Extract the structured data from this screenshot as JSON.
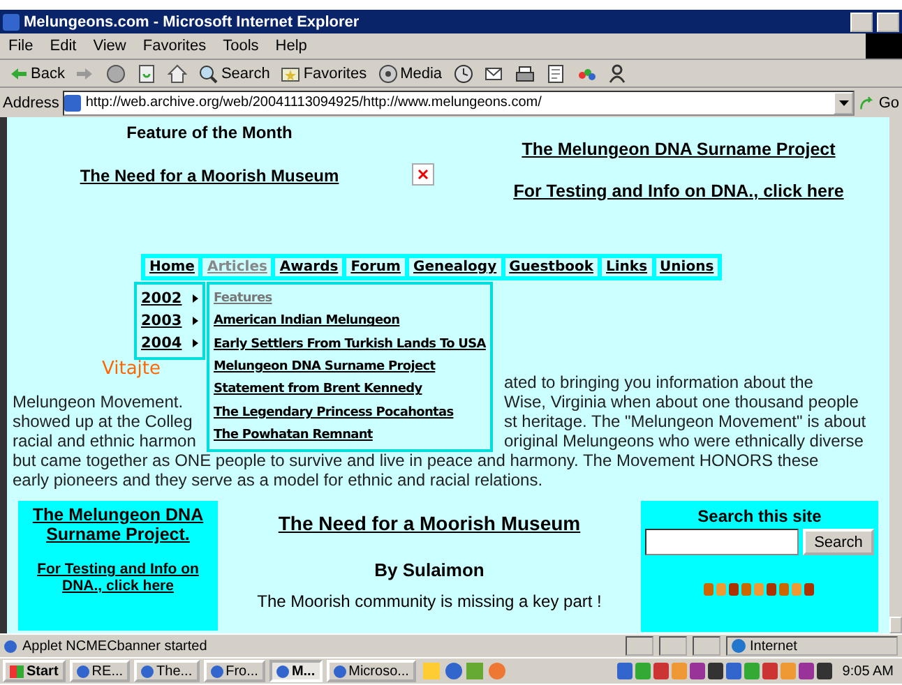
{
  "window": {
    "title": "Melungeons.com - Microsoft Internet Explorer"
  },
  "menu": [
    "File",
    "Edit",
    "View",
    "Favorites",
    "Tools",
    "Help"
  ],
  "toolbar": [
    {
      "kind": "back",
      "label": "Back"
    },
    {
      "kind": "forward"
    },
    {
      "kind": "stop"
    },
    {
      "kind": "refresh"
    },
    {
      "kind": "home"
    },
    {
      "kind": "search",
      "label": "Search"
    },
    {
      "kind": "favorites",
      "label": "Favorites"
    },
    {
      "kind": "media",
      "label": "Media"
    },
    {
      "kind": "history"
    },
    {
      "kind": "mail"
    },
    {
      "kind": "print"
    },
    {
      "kind": "edit"
    },
    {
      "kind": "discuss"
    },
    {
      "kind": "messenger"
    }
  ],
  "address": {
    "label": "Address",
    "value": "http://web.archive.org/web/20041113094925/http://www.melungeons.com/",
    "go": "Go"
  },
  "page": {
    "feature_heading": "Feature of the Month",
    "feature_link": "The Need for a Moorish Museum",
    "right_links": [
      "The Melungeon DNA Surname Project",
      "For Testing and Info on DNA., click here"
    ],
    "nav": [
      {
        "label": "Home",
        "selected": false
      },
      {
        "label": "Articles",
        "selected": true
      },
      {
        "label": "Awards",
        "selected": false
      },
      {
        "label": "Forum",
        "selected": false
      },
      {
        "label": "Genealogy",
        "selected": false
      },
      {
        "label": "Guestbook",
        "selected": false
      },
      {
        "label": "Links",
        "selected": false
      },
      {
        "label": "Unions",
        "selected": false
      }
    ],
    "years": [
      "2002",
      "2003",
      "2004"
    ],
    "submenu": [
      {
        "label": "Features",
        "selected": true
      },
      {
        "label": "American Indian Melungeon",
        "selected": false
      },
      {
        "label": "Early Settlers From Turkish  Lands To USA",
        "selected": false
      },
      {
        "label": "Melungeon DNA Surname Project",
        "selected": false
      },
      {
        "label": "Statement from Brent Kennedy",
        "selected": false
      },
      {
        "label": "The Legendary Princess Pocahontas",
        "selected": false
      },
      {
        "label": "The Powhatan Remnant",
        "selected": false
      }
    ],
    "greeting": "Vitajte",
    "intro_lines": [
      {
        "right": "ated to bringing you information about the"
      },
      {
        "left": "Melungeon Movement.",
        "right": "Wise, Virginia when about one thousand people"
      },
      {
        "left": "showed up at the Colleg",
        "right": "st heritage. The \"Melungeon Movement\" is about"
      },
      {
        "left": "racial and ethnic harmon",
        "right": "original Melungeons who were ethnically diverse"
      },
      {
        "full": "but came together as ONE people to survive and live in peace and harmony. The Movement HONORS these"
      },
      {
        "full": "early pioneers and they serve as a model for ethnic and racial relations."
      }
    ],
    "left_box": {
      "title": "The Melungeon DNA Surname Project.",
      "link": "For Testing and Info on DNA., click here"
    },
    "article": {
      "title": "The Need for a Moorish Museum",
      "byline": "By Sulaimon",
      "text": "The Moorish community is missing a key part !"
    },
    "search": {
      "heading": "Search this site",
      "button": "Search"
    }
  },
  "status_bar": {
    "message": "Applet NCMECbanner started",
    "zone": "Internet"
  },
  "taskbar": {
    "start": "Start",
    "tasks": [
      {
        "label": "RE...",
        "selected": false
      },
      {
        "label": "The...",
        "selected": false
      },
      {
        "label": "Fro...",
        "selected": false
      },
      {
        "label": "M...",
        "selected": true
      },
      {
        "label": "Microso...",
        "selected": false
      }
    ],
    "time": "9:05 AM"
  }
}
